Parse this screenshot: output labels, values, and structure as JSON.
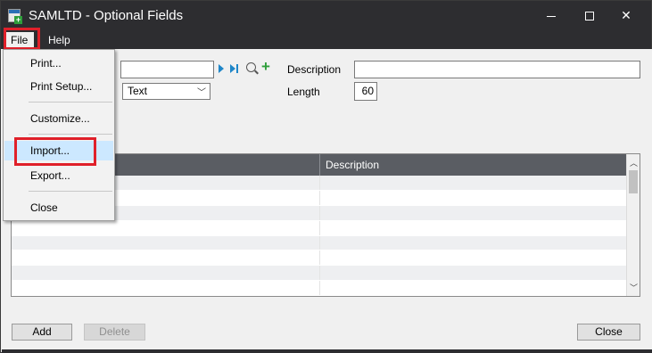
{
  "window": {
    "title": "SAMLTD - Optional Fields",
    "controls": {
      "minimize": "minimize",
      "maximize": "maximize",
      "close": "✕"
    }
  },
  "menubar": {
    "items": [
      "File",
      "Help"
    ]
  },
  "file_menu": {
    "items": [
      "Print...",
      "Print Setup...",
      "Customize...",
      "Import...",
      "Export...",
      "Close"
    ],
    "highlighted": "Import..."
  },
  "form": {
    "optional_field_value": "",
    "type_value": "Text",
    "description_label": "Description",
    "description_value": "",
    "length_label": "Length",
    "length_value": "60"
  },
  "grid": {
    "columns": [
      "",
      "Description"
    ],
    "rows": [
      [
        "",
        ""
      ],
      [
        "",
        ""
      ],
      [
        "",
        ""
      ],
      [
        "",
        ""
      ],
      [
        "",
        ""
      ],
      [
        "",
        ""
      ],
      [
        "",
        ""
      ],
      [
        "",
        ""
      ]
    ]
  },
  "buttons": {
    "add": "Add",
    "delete": "Delete",
    "close": "Close"
  },
  "colors": {
    "titlebar": "#2d2d30",
    "highlight_box": "#e0202a",
    "menu_hover": "#cce8ff",
    "grid_header": "#5a5d63"
  },
  "icons": [
    "app-icon",
    "next-record-icon",
    "last-record-icon",
    "finder-icon",
    "new-record-icon"
  ]
}
